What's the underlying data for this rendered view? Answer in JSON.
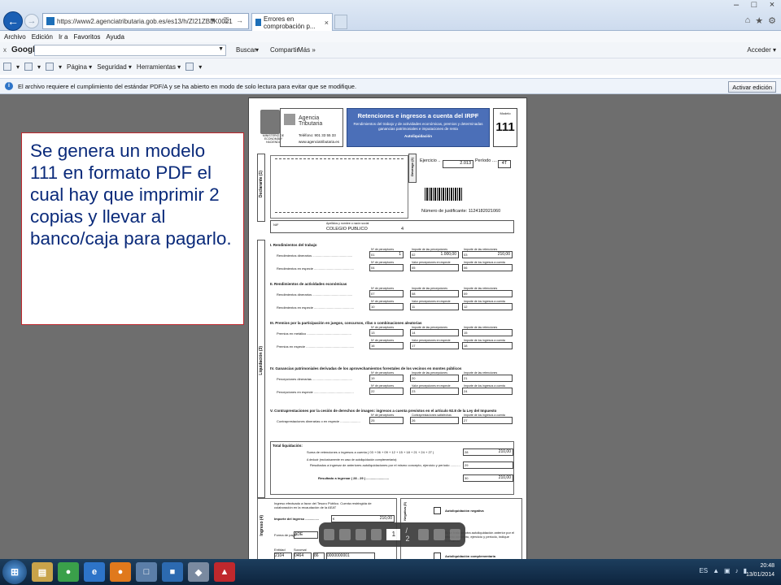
{
  "browser": {
    "url": "https://www2.agenciatributaria.gob.es/es13/h/ZI21ZBLK0021",
    "url_actions": "▼ ⚿ →",
    "tab_title": "Errores en comprobación p...",
    "tab_close": "×",
    "back_icon": "←",
    "forward_icon": "→",
    "window_controls": [
      "–",
      "□",
      "×"
    ],
    "toolbar_icons": [
      "⌂",
      "★",
      "⚙"
    ],
    "menu": [
      "Archivo",
      "Edición",
      "Ir a",
      "Favoritos",
      "Ayuda"
    ],
    "google": {
      "close": "x",
      "logo": "Google",
      "dropdown": "▼",
      "buscar": "Buscar",
      "buscar_arrow": "▾",
      "compartir": "Compartir",
      "mas": "Más »",
      "acceder": "Acceder ▾"
    },
    "command_bar": [
      "▾",
      "▾",
      "▾",
      "Página ▾",
      "Seguridad ▾",
      "Herramientas ▾",
      "▾"
    ],
    "infobar": {
      "icon": "i",
      "text": "El archivo requiere el cumplimiento del estándar PDF/A y se ha abierto en modo de solo lectura para evitar que se modifique.",
      "button": "Activar edición"
    }
  },
  "callout": {
    "text": "Se genera un modelo 111 en formato PDF el cual hay que imprimir 2 copias y llevar al banco/caja para pagarlo."
  },
  "pdf": {
    "logo_caption": "MINISTERIO DE ECONOMÍA Y HACIENDA",
    "agency": "Agencia Tributaria",
    "telefono": "Teléfono: 901 33 55 33",
    "web": "www.agenciatributaria.es",
    "header_title": "Retenciones e ingresos a cuenta del IRPF",
    "header_sub": "Rendimientos del trabajo y de actividades económicas, premios y determinadas ganancias patrimoniales e imputaciones de renta",
    "header_auto": "Autoliquidación",
    "modelo_label": "Modelo",
    "modelo_num": "111",
    "declarante_label": "Declarante (1)",
    "devengo_label": "Devengo (2)",
    "ejercicio_label": "Ejercicio ..",
    "ejercicio": "2.013",
    "periodo_label": "Período ....",
    "periodo": "4T",
    "justificante": "Número de justificante: 1124182021060",
    "nif_label": "NIF",
    "nombre_label": "Apellidos y nombre o razón social",
    "nombre": "COLEGIO PUBLICO",
    "nombre_extra": "4",
    "liquidacion_label": "Liquidación (3)",
    "col_perceptores": "Nº de perceptores",
    "col_importe_perc": "Importe de las percepciones",
    "col_importe_ret": "Importe de las retenciones",
    "col_valor": "Valor percepciones en especie",
    "col_ingresos": "Importe de los ingresos a cuenta",
    "col_contra": "Contraprestaciones satisfechas",
    "sections": [
      {
        "title": "I. Rendimientos del trabajo",
        "rows": [
          "Rendimientos dinerarios ............................................",
          "Rendimientos en especie ............................................"
        ]
      },
      {
        "title": "II. Rendimientos de actividades económicas",
        "rows": [
          "Rendimientos dinerarios ............................................",
          "Rendimientos en especie ............................................"
        ]
      },
      {
        "title": "III. Premios por la participación en juegos, concursos, rifas o combinaciones aleatorias",
        "rows": [
          "Premios en metálico .................................................",
          "Premios en especie ....................................................."
        ]
      },
      {
        "title": "IV. Ganancias patrimoniales derivadas de los aprovechamientos forestales de los vecinos en montes públicos",
        "rows": [
          "Percepciones dinerarias ............................................",
          "Percepciones en especie ............................................"
        ]
      },
      {
        "title": "V. Contraprestaciones por la cesión de derechos de imagen: ingresos a cuenta previstos en el artículo 92.8 de la Ley del Impuesto",
        "rows": [
          "Contraprestaciones dinerarias o en especie ......................"
        ]
      }
    ],
    "box_keys": [
      "01",
      "02",
      "03",
      "04",
      "05",
      "06",
      "07",
      "08",
      "09",
      "10",
      "11",
      "12",
      "13",
      "14",
      "15",
      "16",
      "17",
      "18",
      "19",
      "20",
      "21",
      "22",
      "23",
      "24",
      "25",
      "26",
      "27"
    ],
    "values": {
      "01": "1",
      "02": "1.000,00",
      "03": "210,00"
    },
    "total_label": "Total liquidación:",
    "total_suma": "Suma de retenciones o ingresos a cuenta ( 03 + 06 + 09 + 12 + 15 + 18 + 21 + 24 + 27 )",
    "total_28": "210,00",
    "total_deducir": "A deducir (exclusivamente en caso de autoliquidación complementaria):",
    "total_resultados": "Resultados a ingresar de anteriores autoliquidaciones por el mismo concepto, ejercicio y período ...........",
    "resultado_label": "Resultado a ingresar ( 28 - 29 ) .........................",
    "total_30": "210,00",
    "key_28": "28",
    "key_29": "29",
    "key_30": "30",
    "ingreso_label": "Ingreso (4)",
    "ingreso_text": "Ingreso efectuado a favor del Tesoro Público. Cuenta restringida de colaboración en la recaudación de la AEAT",
    "importe_label": "Importe del ingreso ...............",
    "importe": "210,00",
    "importe_cur": "€",
    "forma_pago": "Forma de pago:",
    "forma_valor": "ADE",
    "entidad_label": "Entidad",
    "sucursal_label": "Sucursal",
    "entidad": "2104",
    "sucursal": "0464",
    "dc": "86",
    "cuenta": "0000000001",
    "negativa_label": "Negativa (5)",
    "autoliq_negativa": "Autoliquidación negativa",
    "complementaria_text": "Si se trata de otra autoliquidación anterior por el mismo concepto, ejercicio y período, indique marcando",
    "autoliq_complementaria": "Autoliquidación complementaria"
  },
  "pdf_toolbar": {
    "page": "1",
    "total": "/ 2"
  },
  "taskbar": {
    "start_icon": "⊞",
    "apps": [
      {
        "name": "explorer-icon",
        "glyph": "▤",
        "color": "#c8a34a"
      },
      {
        "name": "chrome-icon",
        "glyph": "●",
        "color": "#3aa04a"
      },
      {
        "name": "ie-icon",
        "glyph": "e",
        "color": "#2d74c8"
      },
      {
        "name": "firefox-icon",
        "glyph": "●",
        "color": "#e0791c"
      },
      {
        "name": "documents-icon",
        "glyph": "□",
        "color": "#5b7ea8"
      },
      {
        "name": "media-icon",
        "glyph": "■",
        "color": "#2c6ab0"
      },
      {
        "name": "network-icon",
        "glyph": "◆",
        "color": "#7a8aa0"
      },
      {
        "name": "acrobat-icon",
        "glyph": "▲",
        "color": "#c0282d"
      }
    ],
    "lang": "ES",
    "tray_icons": [
      "▲",
      "▣",
      "♪",
      "▮"
    ],
    "time": "20:48",
    "date": "13/01/2014"
  }
}
